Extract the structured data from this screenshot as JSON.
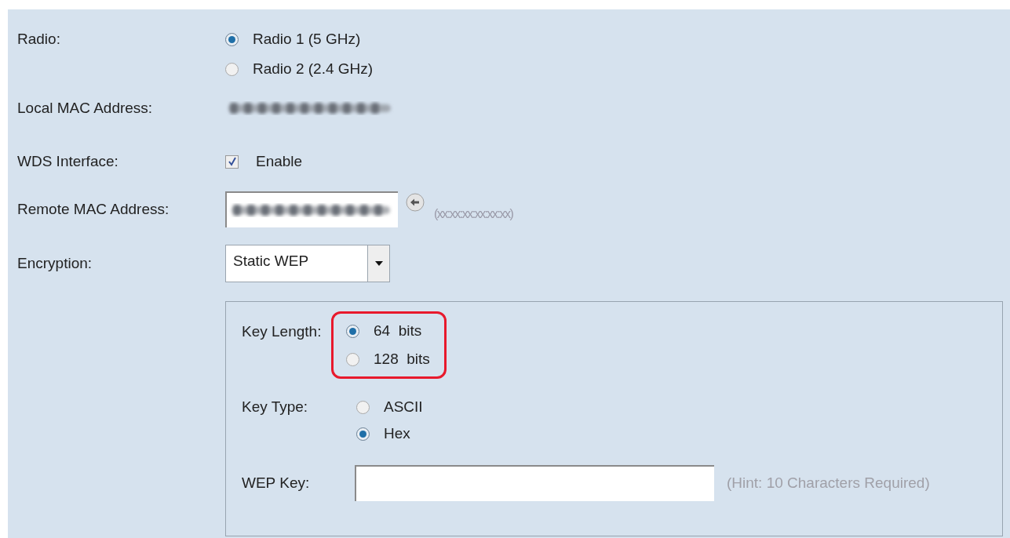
{
  "radio": {
    "label": "Radio:",
    "options": [
      {
        "label": "Radio 1 (5 GHz)",
        "selected": true
      },
      {
        "label": "Radio 2 (2.4 GHz)",
        "selected": false
      }
    ]
  },
  "local_mac": {
    "label": "Local MAC Address:"
  },
  "wds": {
    "label": "WDS Interface:",
    "option": "Enable",
    "checked": true
  },
  "remote_mac": {
    "label": "Remote MAC Address:",
    "hint": "(xx:xx:xx:xx:xx:xx)"
  },
  "encryption": {
    "label": "Encryption:",
    "value": "Static WEP"
  },
  "key_length": {
    "label": "Key Length:",
    "highlighted": true,
    "options": [
      {
        "label": "64  bits",
        "selected": true
      },
      {
        "label": "128  bits",
        "selected": false
      }
    ]
  },
  "key_type": {
    "label": "Key Type:",
    "options": [
      {
        "label": "ASCII",
        "selected": false
      },
      {
        "label": "Hex",
        "selected": true
      }
    ]
  },
  "wep_key": {
    "label": "WEP Key:",
    "hint": "(Hint: 10 Characters Required)"
  }
}
